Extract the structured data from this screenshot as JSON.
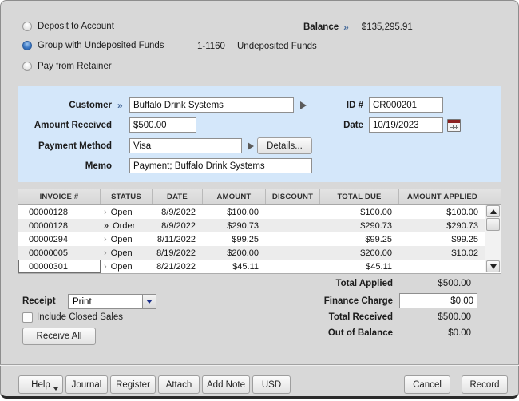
{
  "deposit_options": {
    "items": [
      {
        "label": "Deposit to Account",
        "selected": false
      },
      {
        "label": "Group with Undeposited Funds",
        "selected": true
      },
      {
        "label": "Pay from Retainer",
        "selected": false
      }
    ],
    "account_number": "1-1160",
    "account_name": "Undeposited Funds"
  },
  "balance": {
    "label": "Balance",
    "chevron": "»",
    "value": "$135,295.91"
  },
  "form": {
    "customer": {
      "label": "Customer",
      "chevron": "»",
      "value": "Buffalo Drink Systems"
    },
    "amount_received": {
      "label": "Amount Received",
      "value": "$500.00"
    },
    "payment_method": {
      "label": "Payment Method",
      "value": "Visa"
    },
    "details_button": "Details...",
    "memo": {
      "label": "Memo",
      "value": "Payment; Buffalo Drink Systems"
    },
    "id": {
      "label": "ID #",
      "value": "CR000201"
    },
    "date": {
      "label": "Date",
      "value": "10/19/2023"
    }
  },
  "invoice_table": {
    "columns": [
      "INVOICE #",
      "STATUS",
      "DATE",
      "AMOUNT",
      "DISCOUNT",
      "TOTAL DUE",
      "AMOUNT APPLIED"
    ],
    "sort_column": "DATE",
    "focused_row": 4,
    "rows": [
      {
        "invoice": "00000128",
        "arrow": "›",
        "status": "Open",
        "date": "8/9/2022",
        "amount": "$100.00",
        "discount": "",
        "total_due": "$100.00",
        "amount_applied": "$100.00"
      },
      {
        "invoice": "00000128",
        "arrow": "»",
        "status": "Order",
        "date": "8/9/2022",
        "amount": "$290.73",
        "discount": "",
        "total_due": "$290.73",
        "amount_applied": "$290.73"
      },
      {
        "invoice": "00000294",
        "arrow": "›",
        "status": "Open",
        "date": "8/11/2022",
        "amount": "$99.25",
        "discount": "",
        "total_due": "$99.25",
        "amount_applied": "$99.25"
      },
      {
        "invoice": "00000005",
        "arrow": "›",
        "status": "Open",
        "date": "8/19/2022",
        "amount": "$200.00",
        "discount": "",
        "total_due": "$200.00",
        "amount_applied": "$10.02"
      },
      {
        "invoice": "00000301",
        "arrow": "›",
        "status": "Open",
        "date": "8/21/2022",
        "amount": "$45.11",
        "discount": "",
        "total_due": "$45.11",
        "amount_applied": ""
      }
    ]
  },
  "totals": {
    "total_applied": {
      "label": "Total Applied",
      "value": "$500.00"
    },
    "finance_charge": {
      "label": "Finance Charge",
      "value": "$0.00"
    },
    "total_received": {
      "label": "Total Received",
      "value": "$500.00"
    },
    "out_of_balance": {
      "label": "Out of Balance",
      "value": "$0.00"
    }
  },
  "receipt": {
    "label": "Receipt",
    "value": "Print"
  },
  "include_closed_sales": {
    "label": "Include Closed Sales",
    "checked": false
  },
  "receive_all_button": "Receive All",
  "footer": {
    "help": "Help",
    "journal": "Journal",
    "register": "Register",
    "attach": "Attach",
    "add_note": "Add Note",
    "currency": "USD",
    "cancel": "Cancel",
    "record": "Record"
  }
}
